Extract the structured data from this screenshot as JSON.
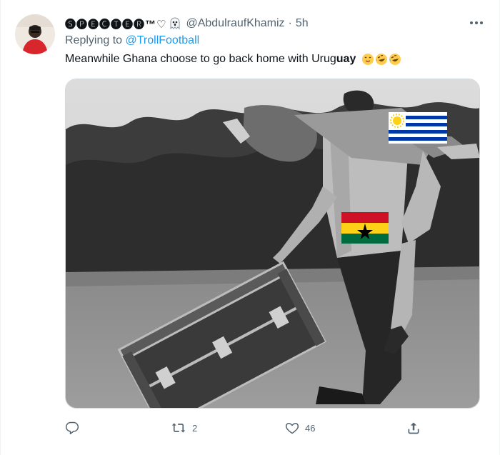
{
  "tweet": {
    "display_name": "🅢🅟🅔🅒🅣🅔🅡™♡",
    "handle": "@AbdulraufKhamiz",
    "separator": "·",
    "time": "5h",
    "replying_prefix": "Replying to ",
    "replying_to": "@TrollFootball",
    "text_before": "Meanwhile Ghana choose to go back home with Urug",
    "text_bold": "uay",
    "emojis": [
      "face-with-tongue-emoji",
      "rolling-on-floor-laughing-emoji",
      "rolling-on-floor-laughing-emoji"
    ],
    "media": {
      "description_icons": [
        "uruguay-flag",
        "ghana-flag"
      ]
    },
    "actions": {
      "reply_count": "",
      "retweet_count": "2",
      "like_count": "46"
    },
    "colors": {
      "accent": "#1d9bf0",
      "secondary_text": "#536471",
      "border": "#cfd9de"
    }
  }
}
